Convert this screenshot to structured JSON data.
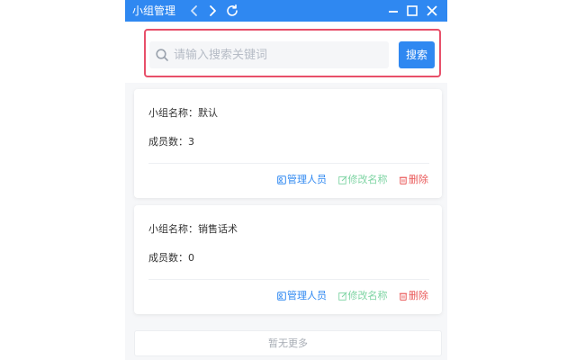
{
  "window": {
    "title": "小组管理"
  },
  "search": {
    "placeholder": "请输入搜索关键词",
    "button_label": "搜索"
  },
  "groups": [
    {
      "name_label": "小组名称：",
      "name": "默认",
      "members_label": "成员数：",
      "members": "3",
      "actions": {
        "manage": "管理人员",
        "rename": "修改名称",
        "delete": "删除"
      }
    },
    {
      "name_label": "小组名称：",
      "name": "销售话术",
      "members_label": "成员数：",
      "members": "0",
      "actions": {
        "manage": "管理人员",
        "rename": "修改名称",
        "delete": "删除"
      }
    }
  ],
  "footer": {
    "no_more": "暂无更多"
  },
  "colors": {
    "titlebar": "#2f88f1",
    "highlight": "#e8506a",
    "manage": "#2f88f1",
    "rename": "#7ed4a3",
    "delete": "#ea5a5a"
  },
  "icons": {
    "titlebar": [
      "chevron-left-icon",
      "chevron-right-icon",
      "refresh-icon",
      "minimize-icon",
      "maximize-icon",
      "close-icon"
    ],
    "search": "search-icon",
    "manage": "user-edit-icon",
    "rename": "edit-icon",
    "delete": "trash-icon"
  }
}
